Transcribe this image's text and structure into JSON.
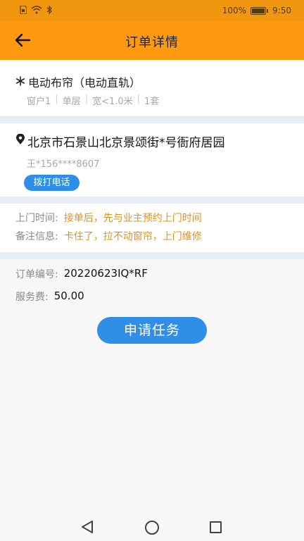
{
  "status_bar": {
    "icons": [
      "sim-icon",
      "wifi-icon",
      "bluetooth-icon"
    ],
    "battery": "100%",
    "time": "9:50"
  },
  "app_bar": {
    "title": "订单详情"
  },
  "product": {
    "icon": "snowflake-icon",
    "name": "电动布帘（电动直轨）",
    "specs": [
      "窗户1",
      "单层",
      "宽<1.0米",
      "1套"
    ]
  },
  "address": {
    "icon": "location-icon",
    "text": "北京市石景山北京景颂街*号衙府居园",
    "contact": "王*156****8607",
    "call_label": "拨打电话"
  },
  "notes": {
    "visit_label": "上门时间:",
    "visit_value": "接单后，先与业主预约上门时间",
    "remark_label": "备注信息:",
    "remark_value": "卡住了，拉不动窗帘，上门维修"
  },
  "order": {
    "number_label": "订单编号:",
    "number_value": "20220623IQ*RF",
    "fee_label": "服务费:",
    "fee_value": "50.00"
  },
  "actions": {
    "apply_label": "申请任务"
  },
  "colors": {
    "accent_orange": "#ff9a10",
    "button_blue": "#2f8ee8",
    "note_orange": "#e69015"
  }
}
